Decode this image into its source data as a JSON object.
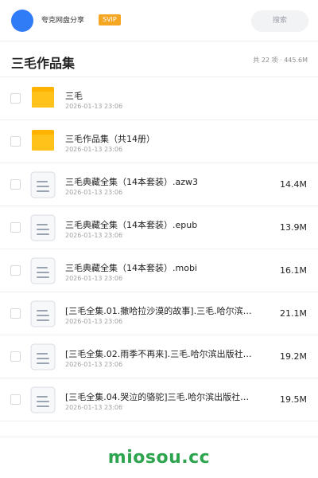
{
  "header": {
    "brand": "夸克网盘分享",
    "badge": "SVIP",
    "search_label": "搜索"
  },
  "folder": {
    "title": "三毛作品集",
    "summary": "共 22 项 · 445.6M"
  },
  "items": [
    {
      "type": "folder",
      "name": "三毛",
      "date": "2026-01-13 23:06",
      "size": ""
    },
    {
      "type": "folder",
      "name": "三毛作品集（共14册）",
      "date": "2026-01-13 23:06",
      "size": ""
    },
    {
      "type": "file",
      "name": "三毛典藏全集（14本套装）.azw3",
      "date": "2026-01-13 23:06",
      "size": "14.4M"
    },
    {
      "type": "file",
      "name": "三毛典藏全集（14本套装）.epub",
      "date": "2026-01-13 23:06",
      "size": "13.9M"
    },
    {
      "type": "file",
      "name": "三毛典藏全集（14本套装）.mobi",
      "date": "2026-01-13 23:06",
      "size": "16.1M"
    },
    {
      "type": "file",
      "name": "[三毛全集.01.撒哈拉沙漠的故事].三毛.哈尔滨…",
      "date": "2026-01-13 23:06",
      "size": "21.1M"
    },
    {
      "type": "file",
      "name": "[三毛全集.02.雨季不再来].三毛.哈尔滨出版社…",
      "date": "2026-01-13 23:06",
      "size": "19.2M"
    },
    {
      "type": "file",
      "name": "[三毛全集.04.哭泣的骆驼]三毛.哈尔滨出版社…",
      "date": "2026-01-13 23:06",
      "size": "19.5M"
    }
  ],
  "watermark": "miosou.cc",
  "colors": {
    "avatar": "#2f7cf6",
    "badge": "#f5a623",
    "folder": "#ffc21a",
    "watermark": "#2ea44f"
  }
}
